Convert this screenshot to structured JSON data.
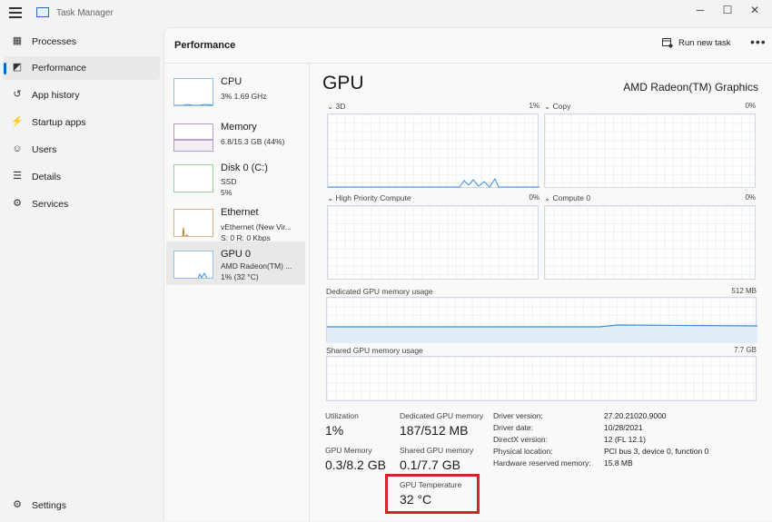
{
  "window": {
    "title": "Task Manager",
    "minimize": "─",
    "maximize": "☐",
    "close": "✕"
  },
  "sidebar": {
    "items": [
      {
        "label": "Processes",
        "icon": "processes-icon"
      },
      {
        "label": "Performance",
        "icon": "performance-icon"
      },
      {
        "label": "App history",
        "icon": "history-icon"
      },
      {
        "label": "Startup apps",
        "icon": "startup-icon"
      },
      {
        "label": "Users",
        "icon": "users-icon"
      },
      {
        "label": "Details",
        "icon": "details-icon"
      },
      {
        "label": "Services",
        "icon": "services-icon"
      }
    ],
    "settings": "Settings"
  },
  "header": {
    "title": "Performance",
    "run_task": "Run new task",
    "more": "•••"
  },
  "devices": [
    {
      "name": "CPU",
      "lines": [
        "3% 1.69 GHz"
      ]
    },
    {
      "name": "Memory",
      "lines": [
        "6.8/15.3 GB (44%)"
      ]
    },
    {
      "name": "Disk 0 (C:)",
      "lines": [
        "SSD",
        "5%"
      ]
    },
    {
      "name": "Ethernet",
      "lines": [
        "vEthernet (New Vir...",
        "S: 0 R: 0 Kbps"
      ]
    },
    {
      "name": "GPU 0",
      "lines": [
        "AMD Radeon(TM) ...",
        "1% (32 °C)"
      ]
    }
  ],
  "gpu": {
    "title": "GPU",
    "model": "AMD Radeon(TM) Graphics",
    "engines": [
      {
        "label": "3D",
        "pct": "1%"
      },
      {
        "label": "Copy",
        "pct": "0%"
      },
      {
        "label": "High Priority Compute",
        "pct": "0%"
      },
      {
        "label": "Compute 0",
        "pct": "0%"
      }
    ],
    "dedicated": {
      "label": "Dedicated GPU memory usage",
      "max": "512 MB"
    },
    "shared": {
      "label": "Shared GPU memory usage",
      "max": "7.7 GB"
    }
  },
  "stats": {
    "utilization": {
      "label": "Utilization",
      "value": "1%"
    },
    "dedicated_mem": {
      "label": "Dedicated GPU memory",
      "value": "187/512 MB"
    },
    "gpu_memory": {
      "label": "GPU Memory",
      "value": "0.3/8.2 GB"
    },
    "shared_mem": {
      "label": "Shared GPU memory",
      "value": "0.1/7.7 GB"
    },
    "temperature": {
      "label": "GPU Temperature",
      "value": "32 °C"
    }
  },
  "info": [
    {
      "k": "Driver version:",
      "v": "27.20.21020.9000"
    },
    {
      "k": "Driver date:",
      "v": "10/28/2021"
    },
    {
      "k": "DirectX version:",
      "v": "12 (FL 12.1)"
    },
    {
      "k": "Physical location:",
      "v": "PCI bus 3, device 0, function 0"
    },
    {
      "k": "Hardware reserved memory:",
      "v": "15.8 MB"
    }
  ]
}
